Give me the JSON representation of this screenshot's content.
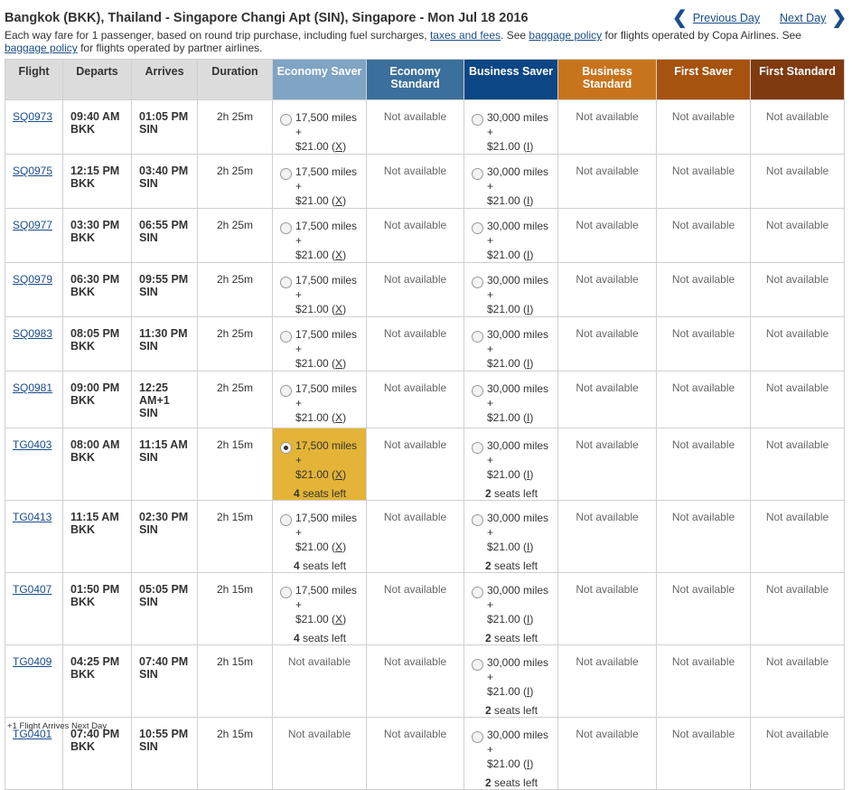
{
  "header": {
    "route": "Bangkok (BKK), Thailand - Singapore Changi Apt (SIN), Singapore - Mon Jul 18 2016",
    "prev_day": "Previous Day",
    "next_day": "Next Day",
    "note_1": "Each way fare for 1 passenger, based on round trip purchase, including fuel surcharges,",
    "taxes_link": "taxes and fees",
    "note_2": ". See",
    "baggage_link_1": "baggage policy",
    "note_3": "for flights operated by Copa Airlines. See",
    "baggage_link_2": "baggage policy",
    "note_4": "for flights operated by partner airlines."
  },
  "columns": {
    "flight": "Flight",
    "departs": "Departs",
    "arrives": "Arrives",
    "duration": "Duration",
    "economy_saver": "Economy Saver",
    "economy_standard": "Economy Standard",
    "business_saver": "Business Saver",
    "business_standard": "Business Standard",
    "first_saver": "First Saver",
    "first_standard": "First Standard"
  },
  "colors": {
    "economy_saver": "#7fa4c4",
    "economy_standard": "#3b6f9c",
    "business_saver": "#0b4685",
    "business_standard": "#c8741d",
    "first_saver": "#a6530f",
    "first_standard": "#803a10",
    "selected": "#e3b437"
  },
  "flights": [
    {
      "flight": "SQ0973",
      "dep_time": "09:40 AM",
      "dep_code": "BKK",
      "arr_time": "01:05 PM",
      "arr_code": "SIN",
      "duration": "2h 25m",
      "economy_saver": {
        "miles": "17,500 miles +",
        "fee": "$21.00",
        "code": "X",
        "seats_n": "",
        "seats_text": ""
      },
      "economy_standard": "Not available",
      "business_saver": {
        "miles": "30,000 miles +",
        "fee": "$21.00",
        "code": "I",
        "seats_n": "",
        "seats_text": ""
      },
      "business_standard": "Not available",
      "first_saver": "Not available",
      "first_standard": "Not available"
    },
    {
      "flight": "SQ0975",
      "dep_time": "12:15 PM",
      "dep_code": "BKK",
      "arr_time": "03:40 PM",
      "arr_code": "SIN",
      "duration": "2h 25m",
      "economy_saver": {
        "miles": "17,500 miles +",
        "fee": "$21.00",
        "code": "X",
        "seats_n": "",
        "seats_text": ""
      },
      "economy_standard": "Not available",
      "business_saver": {
        "miles": "30,000 miles +",
        "fee": "$21.00",
        "code": "I",
        "seats_n": "",
        "seats_text": ""
      },
      "business_standard": "Not available",
      "first_saver": "Not available",
      "first_standard": "Not available"
    },
    {
      "flight": "SQ0977",
      "dep_time": "03:30 PM",
      "dep_code": "BKK",
      "arr_time": "06:55 PM",
      "arr_code": "SIN",
      "duration": "2h 25m",
      "economy_saver": {
        "miles": "17,500 miles +",
        "fee": "$21.00",
        "code": "X",
        "seats_n": "",
        "seats_text": ""
      },
      "economy_standard": "Not available",
      "business_saver": {
        "miles": "30,000 miles +",
        "fee": "$21.00",
        "code": "I",
        "seats_n": "",
        "seats_text": ""
      },
      "business_standard": "Not available",
      "first_saver": "Not available",
      "first_standard": "Not available"
    },
    {
      "flight": "SQ0979",
      "dep_time": "06:30 PM",
      "dep_code": "BKK",
      "arr_time": "09:55 PM",
      "arr_code": "SIN",
      "duration": "2h 25m",
      "economy_saver": {
        "miles": "17,500 miles +",
        "fee": "$21.00",
        "code": "X",
        "seats_n": "",
        "seats_text": ""
      },
      "economy_standard": "Not available",
      "business_saver": {
        "miles": "30,000 miles +",
        "fee": "$21.00",
        "code": "I",
        "seats_n": "",
        "seats_text": ""
      },
      "business_standard": "Not available",
      "first_saver": "Not available",
      "first_standard": "Not available"
    },
    {
      "flight": "SQ0983",
      "dep_time": "08:05 PM",
      "dep_code": "BKK",
      "arr_time": "11:30 PM",
      "arr_code": "SIN",
      "duration": "2h 25m",
      "economy_saver": {
        "miles": "17,500 miles +",
        "fee": "$21.00",
        "code": "X",
        "seats_n": "",
        "seats_text": ""
      },
      "economy_standard": "Not available",
      "business_saver": {
        "miles": "30,000 miles +",
        "fee": "$21.00",
        "code": "I",
        "seats_n": "",
        "seats_text": ""
      },
      "business_standard": "Not available",
      "first_saver": "Not available",
      "first_standard": "Not available"
    },
    {
      "flight": "SQ0981",
      "dep_time": "09:00 PM",
      "dep_code": "BKK",
      "arr_time": "12:25 AM+1",
      "arr_code": "SIN",
      "duration": "2h 25m",
      "economy_saver": {
        "miles": "17,500 miles +",
        "fee": "$21.00",
        "code": "X",
        "seats_n": "",
        "seats_text": ""
      },
      "economy_standard": "Not available",
      "business_saver": {
        "miles": "30,000 miles +",
        "fee": "$21.00",
        "code": "I",
        "seats_n": "",
        "seats_text": ""
      },
      "business_standard": "Not available",
      "first_saver": "Not available",
      "first_standard": "Not available"
    },
    {
      "flight": "TG0403",
      "dep_time": "08:00 AM",
      "dep_code": "BKK",
      "arr_time": "11:15 AM",
      "arr_code": "SIN",
      "duration": "2h 15m",
      "selected": true,
      "economy_saver": {
        "miles": "17,500 miles +",
        "fee": "$21.00",
        "code": "X",
        "seats_n": "4",
        "seats_text": " seats left"
      },
      "economy_standard": "Not available",
      "business_saver": {
        "miles": "30,000 miles +",
        "fee": "$21.00",
        "code": "I",
        "seats_n": "2",
        "seats_text": " seats left"
      },
      "business_standard": "Not available",
      "first_saver": "Not available",
      "first_standard": "Not available"
    },
    {
      "flight": "TG0413",
      "dep_time": "11:15 AM",
      "dep_code": "BKK",
      "arr_time": "02:30 PM",
      "arr_code": "SIN",
      "duration": "2h 15m",
      "economy_saver": {
        "miles": "17,500 miles +",
        "fee": "$21.00",
        "code": "X",
        "seats_n": "4",
        "seats_text": " seats left"
      },
      "economy_standard": "Not available",
      "business_saver": {
        "miles": "30,000 miles +",
        "fee": "$21.00",
        "code": "I",
        "seats_n": "2",
        "seats_text": " seats left"
      },
      "business_standard": "Not available",
      "first_saver": "Not available",
      "first_standard": "Not available"
    },
    {
      "flight": "TG0407",
      "dep_time": "01:50 PM",
      "dep_code": "BKK",
      "arr_time": "05:05 PM",
      "arr_code": "SIN",
      "duration": "2h 15m",
      "economy_saver": {
        "miles": "17,500 miles +",
        "fee": "$21.00",
        "code": "X",
        "seats_n": "4",
        "seats_text": " seats left"
      },
      "economy_standard": "Not available",
      "business_saver": {
        "miles": "30,000 miles +",
        "fee": "$21.00",
        "code": "I",
        "seats_n": "2",
        "seats_text": " seats left"
      },
      "business_standard": "Not available",
      "first_saver": "Not available",
      "first_standard": "Not available"
    },
    {
      "flight": "TG0409",
      "dep_time": "04:25 PM",
      "dep_code": "BKK",
      "arr_time": "07:40 PM",
      "arr_code": "SIN",
      "duration": "2h 15m",
      "economy_saver": "Not available",
      "economy_standard": "Not available",
      "business_saver": {
        "miles": "30,000 miles +",
        "fee": "$21.00",
        "code": "I",
        "seats_n": "2",
        "seats_text": " seats left"
      },
      "business_standard": "Not available",
      "first_saver": "Not available",
      "first_standard": "Not available"
    },
    {
      "flight": "TG0401",
      "dep_time": "07:40 PM",
      "dep_code": "BKK",
      "arr_time": "10:55 PM",
      "arr_code": "SIN",
      "duration": "2h 15m",
      "economy_saver": "Not available",
      "economy_standard": "Not available",
      "business_saver": {
        "miles": "30,000 miles +",
        "fee": "$21.00",
        "code": "I",
        "seats_n": "2",
        "seats_text": " seats left"
      },
      "business_standard": "Not available",
      "first_saver": "Not available",
      "first_standard": "Not available"
    }
  ],
  "footnote": "+1 Flight Arrives Next Day"
}
